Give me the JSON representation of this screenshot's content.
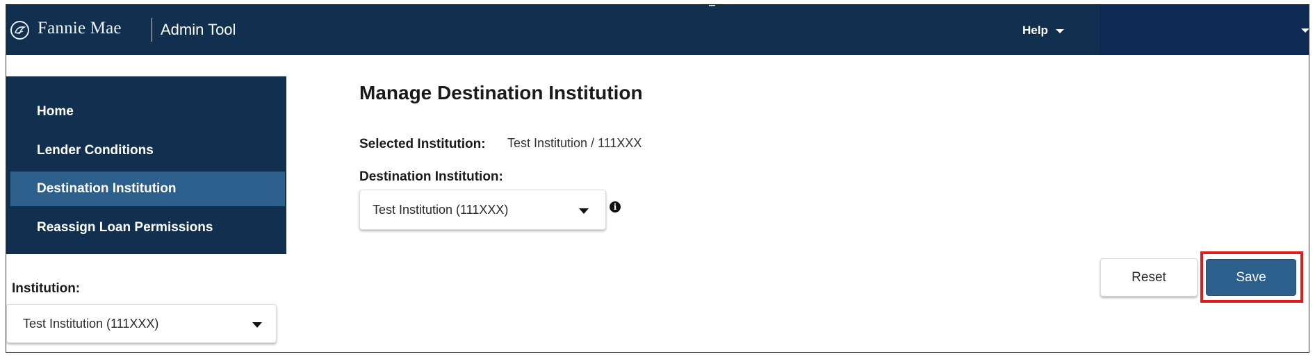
{
  "header": {
    "brand": "Fannie Mae",
    "app_name": "Admin Tool",
    "help_label": "Help"
  },
  "sidebar": {
    "items": [
      {
        "label": "Home"
      },
      {
        "label": "Lender Conditions"
      },
      {
        "label": "Destination Institution"
      },
      {
        "label": "Reassign Loan Permissions"
      }
    ],
    "active_item": "Destination Institution",
    "institution_label": "Institution:",
    "institution_value": "Test Institution (111XXX)"
  },
  "main": {
    "title": "Manage Destination Institution",
    "selected_label": "Selected Institution:",
    "selected_value": "Test Institution / 111XXX",
    "destination_label": "Destination Institution:",
    "destination_value": "Test Institution (111XXX)",
    "reset_label": "Reset",
    "save_label": "Save"
  },
  "colors": {
    "header_bg": "#11304f",
    "active_nav": "#2d5f8c",
    "primary_button": "#2d5f8c",
    "highlight": "#e01b1b"
  },
  "icons": [
    "fannie-mae-logo-icon",
    "help-caret-icon",
    "user-menu-caret-icon",
    "dropdown-caret-icon",
    "info-icon"
  ]
}
